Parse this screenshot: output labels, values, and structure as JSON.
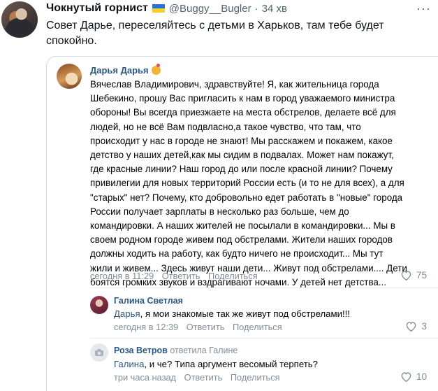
{
  "tweet": {
    "author_name": "Чокнутый горнист",
    "handle": "@Buggy__Bugler",
    "separator": "·",
    "time": "34 хв",
    "more_icon": "more-dots-icon",
    "text": "Совет Дарье, переселяйтесь с детьми в Харьков, там тебе будет спокойно.",
    "flag_colors": [
      "#2a6fd6",
      "#f5cf2e"
    ]
  },
  "post": {
    "author": "Дарья Дарья",
    "text": "Вячеслав Владимирович, здравствуйте! Я, как жительница города\nШебекино, прошу Вас пригласить к нам в город уважаемого министра\nобороны! Вы всегда приезжаете на места обстрелов, делаете всё для\nлюдей, но не всё Вам подвласно,а такое чувство, что там, что\nпроисходит у нас в городе не знают! Мы расскажем и покажем, какое\nдетство у наших детей,как мы сидим в подвалах. Может нам покажут,\nгде красные линии? Наш город до или после красной линии? Почему\nпривилегии для новых территорий России есть (и то не для всех), а для\n\"старых\" нет? Почему, кто добровольно едет работать в \"новые\" города\nРоссии получает зарплаты в несколько раз больше, чем до\nкомандировки. А наших жителей не посылали в командировки... Мы в\nсвоем родном городе живем под обстрелами. Жители наших городов\nдолжны ходить на работу, как будто ничего не происходит... Мы тут\nжили и живем... Здесь живут наши дети... Живут под обстрелами.... Дети\nбоятся громких звуков и вздрагивают ночами. У детей нет детства...",
    "time": "сегодня в 11:29",
    "reply_label": "Ответить",
    "share_label": "Поделиться",
    "likes": "75"
  },
  "comments": [
    {
      "author": "Галина Светлая",
      "replied_to": "",
      "mention": "Дарья",
      "text": ", я мои знакомые так же живут под обстрелами!!!",
      "time": "сегодня в 12:39",
      "reply_label": "Ответить",
      "share_label": "Поделиться",
      "likes": "3"
    },
    {
      "author": "Роза Ветров",
      "replied_to": "ответила Галине",
      "mention": "Галина",
      "text": ", и че? Типа аргумент весомый терпеть?",
      "time": "три часа назад",
      "reply_label": "Ответить",
      "share_label": "Поделиться",
      "likes": "10"
    }
  ],
  "colors": {
    "vk_link": "#2a5885",
    "vk_meta": "#818c99",
    "twitter_secondary": "#536471"
  }
}
